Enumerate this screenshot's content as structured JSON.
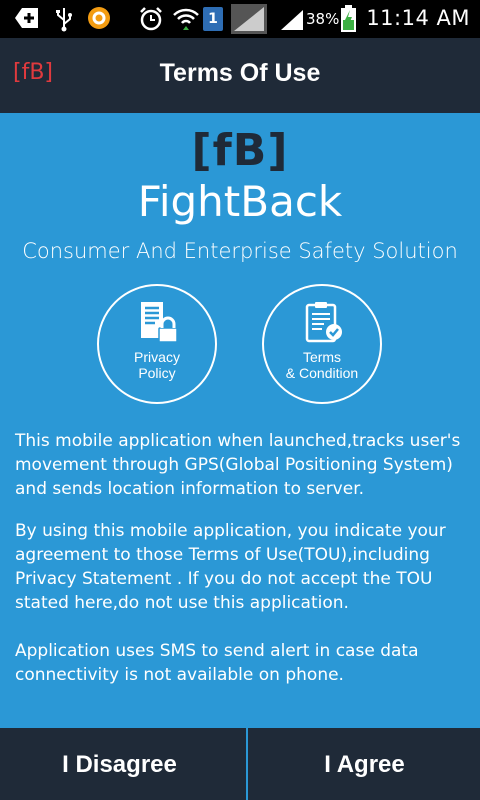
{
  "status_bar": {
    "battery_percent": "38%",
    "time": "11:14 AM",
    "sim_slot": "1",
    "icons": [
      "add-icon",
      "usb-icon",
      "app-notification-icon",
      "alarm-icon",
      "wifi-icon",
      "sim-icon",
      "signal-icon",
      "signal-icon",
      "battery-charging-icon"
    ]
  },
  "header": {
    "logo": "[fB]",
    "title": "Terms Of Use",
    "logo_color": "#e03a3e"
  },
  "brand": {
    "mark": "[fB]",
    "name": "FightBack",
    "tagline": "Consumer And Enterprise Safety Solution"
  },
  "buttons": {
    "privacy_line1": "Privacy",
    "privacy_line2": "Policy",
    "privacy_icon": "document-lock-icon",
    "terms_line1": "Terms",
    "terms_line2": "& Condition",
    "terms_icon": "clipboard-check-icon"
  },
  "paragraphs": {
    "p1": " This mobile application when launched,tracks user's movement through GPS(Global Positioning System) and sends location information to server.",
    "p2": "By using this mobile application, you indicate your agreement to those Terms of Use(TOU),including Privacy Statement . If you do not accept the TOU stated here,do not use this application.",
    "p3": " Application uses SMS to send alert in case data connectivity is not available on phone."
  },
  "footer": {
    "disagree": "I Disagree",
    "agree": "I Agree"
  },
  "colors": {
    "panel": "#2b98d6",
    "dark": "#1f2a38",
    "accent": "#e03a3e"
  }
}
